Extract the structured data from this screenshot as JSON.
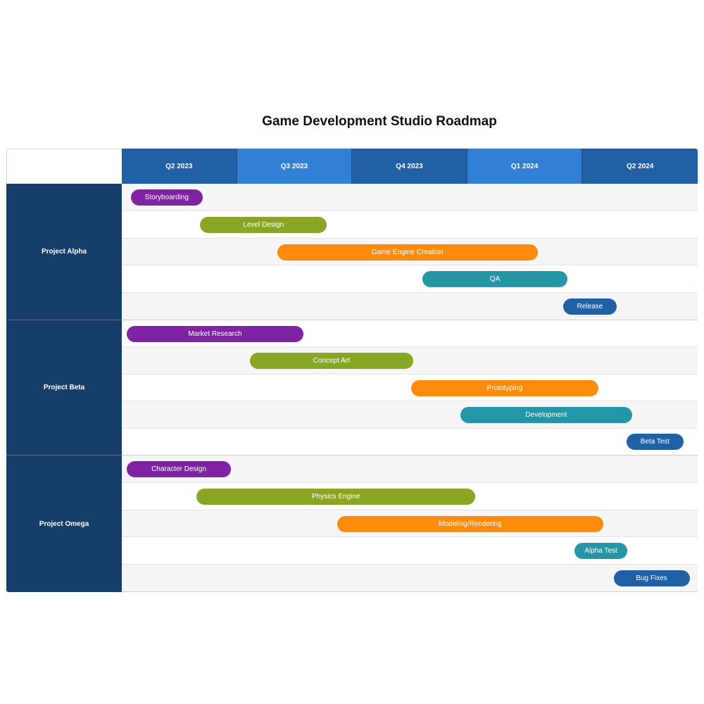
{
  "colors": {
    "header_dark": "#2160a4",
    "header_light": "#3180d6",
    "project_bg": "#173e6b",
    "row_alt": "#f5f5f5",
    "purple": "#7f22a3",
    "green": "#89a524",
    "orange": "#ff8b0d",
    "teal": "#2596a6",
    "blue": "#2160a4"
  },
  "chart_data": {
    "type": "gantt",
    "title": "Game Development Studio Roadmap",
    "x_axis": {
      "unit": "quarter",
      "categories": [
        "Q2 2023",
        "Q3 2023",
        "Q4 2023",
        "Q1 2024",
        "Q2 2024"
      ],
      "range": [
        0,
        5
      ]
    },
    "groups": [
      {
        "name": "Project Alpha",
        "tasks": [
          {
            "name": "Storyboarding",
            "start": 0.08,
            "end": 0.7,
            "color": "purple"
          },
          {
            "name": "Level Design",
            "start": 0.68,
            "end": 1.78,
            "color": "green"
          },
          {
            "name": "Game Engine Creation",
            "start": 1.35,
            "end": 3.61,
            "color": "orange"
          },
          {
            "name": "QA",
            "start": 2.61,
            "end": 3.87,
            "color": "teal"
          },
          {
            "name": "Release",
            "start": 3.83,
            "end": 4.3,
            "color": "blue"
          }
        ]
      },
      {
        "name": "Project Beta",
        "tasks": [
          {
            "name": "Market Research",
            "start": 0.04,
            "end": 1.58,
            "color": "purple"
          },
          {
            "name": "Concept Art",
            "start": 1.11,
            "end": 2.53,
            "color": "green"
          },
          {
            "name": "Prototyping",
            "start": 2.51,
            "end": 4.14,
            "color": "orange"
          },
          {
            "name": "Development",
            "start": 2.94,
            "end": 4.43,
            "color": "teal"
          },
          {
            "name": "Beta Test",
            "start": 4.38,
            "end": 4.88,
            "color": "blue"
          }
        ]
      },
      {
        "name": "Project Omega",
        "tasks": [
          {
            "name": "Character Design",
            "start": 0.04,
            "end": 0.95,
            "color": "purple"
          },
          {
            "name": "Physics Engine",
            "start": 0.65,
            "end": 3.07,
            "color": "green"
          },
          {
            "name": "Modeling/Rendering",
            "start": 1.87,
            "end": 4.18,
            "color": "orange"
          },
          {
            "name": "Alpha Test",
            "start": 3.93,
            "end": 4.39,
            "color": "teal"
          },
          {
            "name": "Bug Fixes",
            "start": 4.27,
            "end": 4.93,
            "color": "blue"
          }
        ]
      }
    ]
  }
}
